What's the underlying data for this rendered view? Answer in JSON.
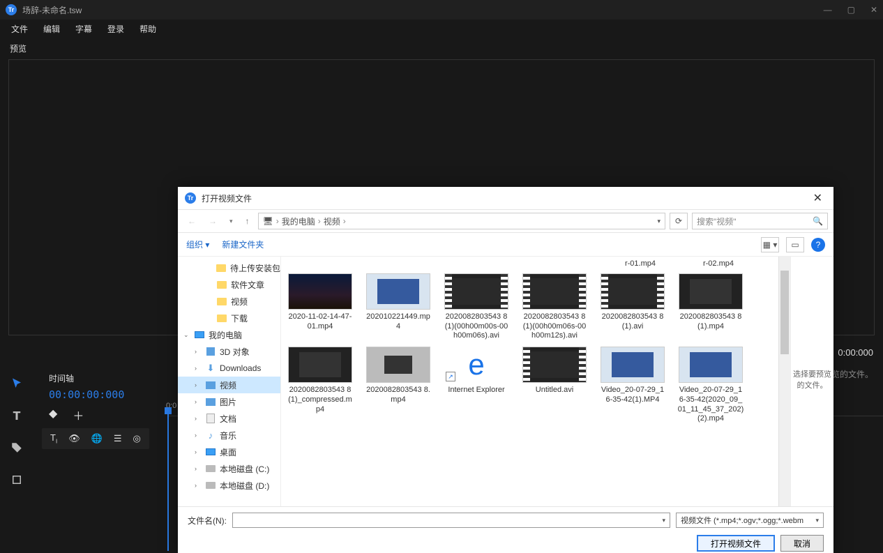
{
  "app": {
    "title": "场辞-未命名.tsw",
    "menu": [
      "文件",
      "编辑",
      "字幕",
      "登录",
      "帮助"
    ],
    "preview_label": "预览",
    "right_time": "0:00:000",
    "right_label": "选择要预览的文件。"
  },
  "timeline": {
    "label": "时间轴",
    "code": "00:00:00:000",
    "ruler_zero": "0:0"
  },
  "dialog": {
    "title": "打开视频文件",
    "path": {
      "root": "我的电脑",
      "folder": "视频"
    },
    "search_placeholder": "搜索\"视频\"",
    "organize": "组织",
    "new_folder": "新建文件夹",
    "residual": [
      "r-01.mp4",
      "r-02.mp4"
    ],
    "tree": [
      {
        "level": 3,
        "icon": "folder",
        "label": "待上传安装包"
      },
      {
        "level": 3,
        "icon": "folder",
        "label": "软件文章"
      },
      {
        "level": 3,
        "icon": "folder",
        "label": "视频"
      },
      {
        "level": 3,
        "icon": "folder",
        "label": "下载"
      },
      {
        "level": 1,
        "icon": "monitor",
        "label": "我的电脑",
        "exp": "v"
      },
      {
        "level": 2,
        "icon": "obj",
        "label": "3D 对象",
        "exp": ">"
      },
      {
        "level": 2,
        "icon": "download",
        "label": "Downloads",
        "exp": ">"
      },
      {
        "level": 2,
        "icon": "video",
        "label": "视频",
        "exp": ">",
        "selected": true
      },
      {
        "level": 2,
        "icon": "pic",
        "label": "图片",
        "exp": ">"
      },
      {
        "level": 2,
        "icon": "doc",
        "label": "文档",
        "exp": ">"
      },
      {
        "level": 2,
        "icon": "music",
        "label": "音乐",
        "exp": ">"
      },
      {
        "level": 2,
        "icon": "monitor",
        "label": "桌面",
        "exp": ">"
      },
      {
        "level": 2,
        "icon": "disk",
        "label": "本地磁盘 (C:)",
        "exp": ">"
      },
      {
        "level": 2,
        "icon": "disk",
        "label": "本地磁盘 (D:)",
        "exp": ">"
      }
    ],
    "files": [
      {
        "name": "2020-11-02-14-47-01.mp4",
        "thumb": "sky"
      },
      {
        "name": "202010221449.mp4",
        "thumb": "light"
      },
      {
        "name": "2020082803543 8 (1)(00h00m00s-00h00m06s).avi",
        "thumb": "film"
      },
      {
        "name": "2020082803543 8 (1)(00h00m06s-00h00m12s).avi",
        "thumb": "film"
      },
      {
        "name": "2020082803543 8 (1).avi",
        "thumb": "film"
      },
      {
        "name": "2020082803543 8 (1).mp4",
        "thumb": "dark"
      },
      {
        "name": "2020082803543 8 (1)_compressed.mp4",
        "thumb": "dark"
      },
      {
        "name": "2020082803543 8.mp4",
        "thumb": "grey"
      },
      {
        "name": "Internet Explorer",
        "thumb": "ie",
        "shortcut": true
      },
      {
        "name": "Untitled.avi",
        "thumb": "film"
      },
      {
        "name": "Video_20-07-29_16-35-42(1).MP4",
        "thumb": "light"
      },
      {
        "name": "Video_20-07-29_16-35-42(2020_09_01_11_45_37_202) (2).mp4",
        "thumb": "light"
      }
    ],
    "preview_hint": "选择要预览的文件。",
    "filename_label": "文件名(N):",
    "filetype_label": "视频文件 (*.mp4;*.ogv;*.ogg;*.webm",
    "open_btn": "打开视频文件",
    "cancel_btn": "取消"
  }
}
